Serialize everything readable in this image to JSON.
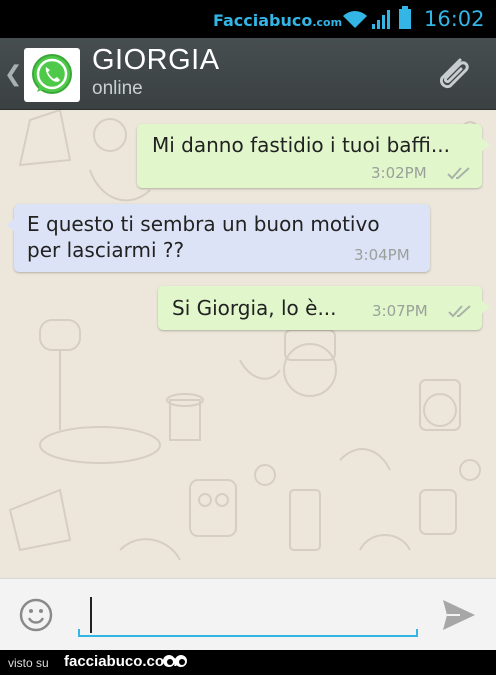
{
  "status_bar": {
    "watermark": "Facciabuco",
    "watermark_suffix": ".com",
    "time": "16:02",
    "icons": [
      "wifi-icon",
      "signal-icon",
      "battery-icon"
    ],
    "accent_color": "#33b5e5"
  },
  "header": {
    "contact_name": "GIORGIA",
    "contact_status": "online",
    "icons": [
      "back-chevron-icon",
      "whatsapp-avatar-icon",
      "paperclip-attach-icon"
    ]
  },
  "messages": [
    {
      "direction": "outgoing",
      "lines": [
        "Mi danno fastidio i tuoi baffi..."
      ],
      "time": "3:02PM",
      "read_ticks": true
    },
    {
      "direction": "incoming",
      "lines": [
        "E questo ti sembra un buon motivo",
        "per lasciarmi ??"
      ],
      "time": "3:04PM",
      "read_ticks": false
    },
    {
      "direction": "outgoing",
      "lines": [
        "Si Giorgia, lo è..."
      ],
      "time": "3:07PM",
      "read_ticks": true
    }
  ],
  "composer": {
    "value": "",
    "icons": [
      "emoji-icon",
      "send-icon"
    ]
  },
  "footer": {
    "prefix": "visto su",
    "site": "facciabuco.com"
  },
  "colors": {
    "outgoing_bubble": "#e1f7cb",
    "incoming_bubble": "#dde3f6",
    "chat_background": "#ede7db",
    "header_background": "#434a4c"
  }
}
